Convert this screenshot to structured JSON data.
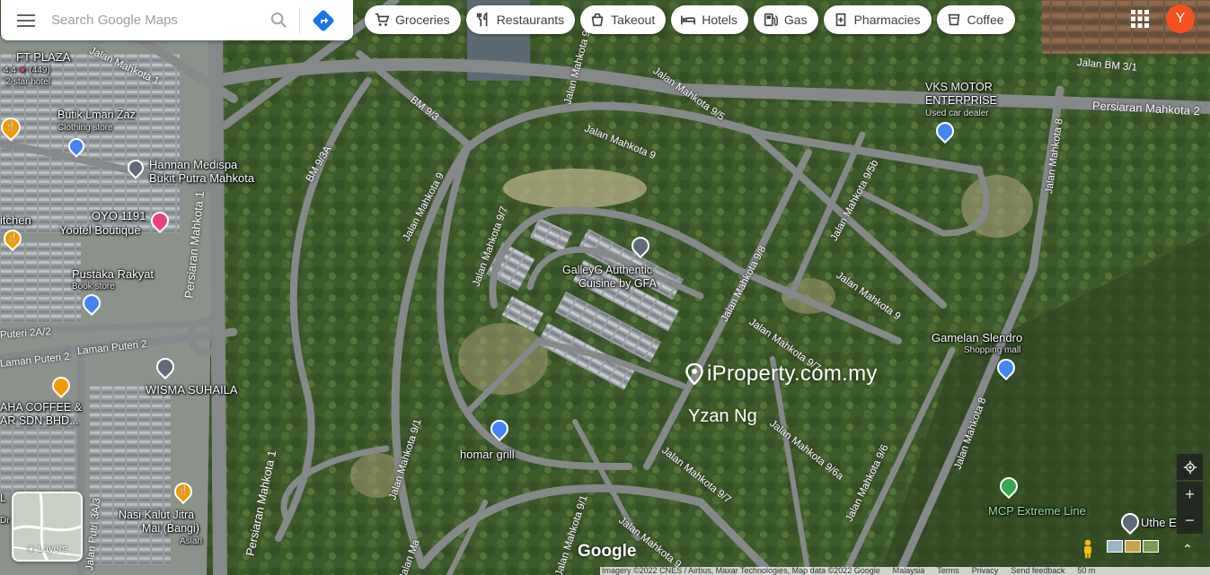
{
  "search": {
    "placeholder": "Search Google Maps"
  },
  "chips": [
    {
      "label": "Groceries",
      "icon": "cart-icon"
    },
    {
      "label": "Restaurants",
      "icon": "fork-knife-icon"
    },
    {
      "label": "Takeout",
      "icon": "takeout-icon"
    },
    {
      "label": "Hotels",
      "icon": "bed-icon"
    },
    {
      "label": "Gas",
      "icon": "gas-pump-icon"
    },
    {
      "label": "Pharmacies",
      "icon": "pharmacy-icon"
    },
    {
      "label": "Coffee",
      "icon": "coffee-icon"
    }
  ],
  "account": {
    "initial": "Y",
    "color": "#f4511e"
  },
  "places": {
    "ft_plaza": {
      "name": "FT PLAZA",
      "rating": "4.4",
      "reviews": "(449)",
      "type": "2-star hotel"
    },
    "butik": {
      "name": "Butik Lmari Zaz",
      "type": "Clothing store"
    },
    "hannan": {
      "name1": "Hannan Medispa",
      "name2": "Bukit Putra Mahkota"
    },
    "oyo": {
      "name1": "OYO 1191",
      "name2": "Yootel Boutique"
    },
    "kitchen": {
      "name": "itchen"
    },
    "pustaka": {
      "name": "Pustaka Rakyat",
      "type": "Book store"
    },
    "wisma": {
      "name": "WISMA SUHAILA"
    },
    "coffee_sdn": {
      "name1": "AHA COFFEE &",
      "name2": "AR SDN BHD..."
    },
    "galleyg": {
      "name1": "GalleyG Authentic",
      "name2": "Cuisine by GFA"
    },
    "homar": {
      "name": "homar grill"
    },
    "vks": {
      "name1": "VKS MOTOR",
      "name2": "ENTERPRISE",
      "type": "Used car dealer"
    },
    "gamelan": {
      "name": "Gamelan Slendro",
      "type": "Shopping mall"
    },
    "mcp": {
      "name": "MCP Extreme Line"
    },
    "uthe": {
      "name": "Uthe E"
    },
    "nasi": {
      "name1": "Nasi Kalut Jitra",
      "name2": "Mai (Bangi)",
      "type": "Asian"
    },
    "l_place": {
      "name1": "L",
      "name2": "Dr"
    }
  },
  "roads": {
    "persiaran_mahkota_2": "Persiaran Mahkota 2",
    "jalan_bm_3_1": "Jalan BM 3/1",
    "persiaran_mahkota_1": "Persiaran Mahkota 1",
    "persiaran_mahkota_1b": "Persiaran Mahkota 1",
    "jalan_mahkota_1": "Jalan Mahkota 1",
    "bm_9_3": "BM 9/3",
    "bm_9_3a": "BM 9/3A",
    "jalan_mahkota_9": "Jalan Mahkota 9",
    "jalan_mahkota_9b": "Jalan Mahkota 9",
    "jalan_mahkota_9c": "Jalan Mahkota 9",
    "jalan_mahkota_9d": "Jalan Mahkota 9",
    "jalan_mahkota_9_3": "Jalan Mahkota 9/3",
    "jalan_mahkota_9_5": "Jalan Mahkota 9/5",
    "jalan_mahkota_9_5b": "Jalan Mahkota 9/5b",
    "jalan_mahkota_9_7": "Jalan Mahkota 9/7",
    "jalan_mahkota_9_7b": "Jalan Mahkota 9/7",
    "jalan_mahkota_9_7c": "Jalan Mahkota 9/7",
    "jalan_mahkota_9_8": "Jalan Mahkota 9/8",
    "jalan_mahkota_9_6": "Jalan Mahkota 9/6",
    "jalan_mahkota_9_6a": "Jalan Mahkota 9/6a",
    "jalan_mahkota_9_1": "Jalan Mahkota 9/1",
    "jalan_mahkota_9_1b": "Jalan Mahkota 9/1",
    "jalan_mahkota_8": "Jalan Mahkota 8",
    "jalan_mahkota_8b": "Jalan Mahkota 8",
    "puteri_2a_2": "Puteri 2A/2",
    "laman_puteri_2": "Laman Puteri 2",
    "laman_puteri_2b": "Laman Puteri 2",
    "jalan_putri_3a_3": "Jalan Putri 3A/3",
    "jalan_ma": "Jalan Ma"
  },
  "watermark": {
    "site": "iProperty.com.my",
    "user": "Yzan Ng"
  },
  "layers": {
    "label": "Layers"
  },
  "google_logo": "Google",
  "footer": {
    "imagery": "Imagery ©2022 CNES / Airbus, Maxar Technologies, Map data ©2022 Google",
    "country": "Malaysia",
    "terms": "Terms",
    "privacy": "Privacy",
    "feedback": "Send feedback",
    "scale": "50 m"
  },
  "colors": {
    "road": "#8a8f86",
    "vegetation": "#3f5a2c",
    "accent_blue": "#4285f4",
    "food_pin": "#f29900",
    "hotel_pin": "#e8437a"
  }
}
